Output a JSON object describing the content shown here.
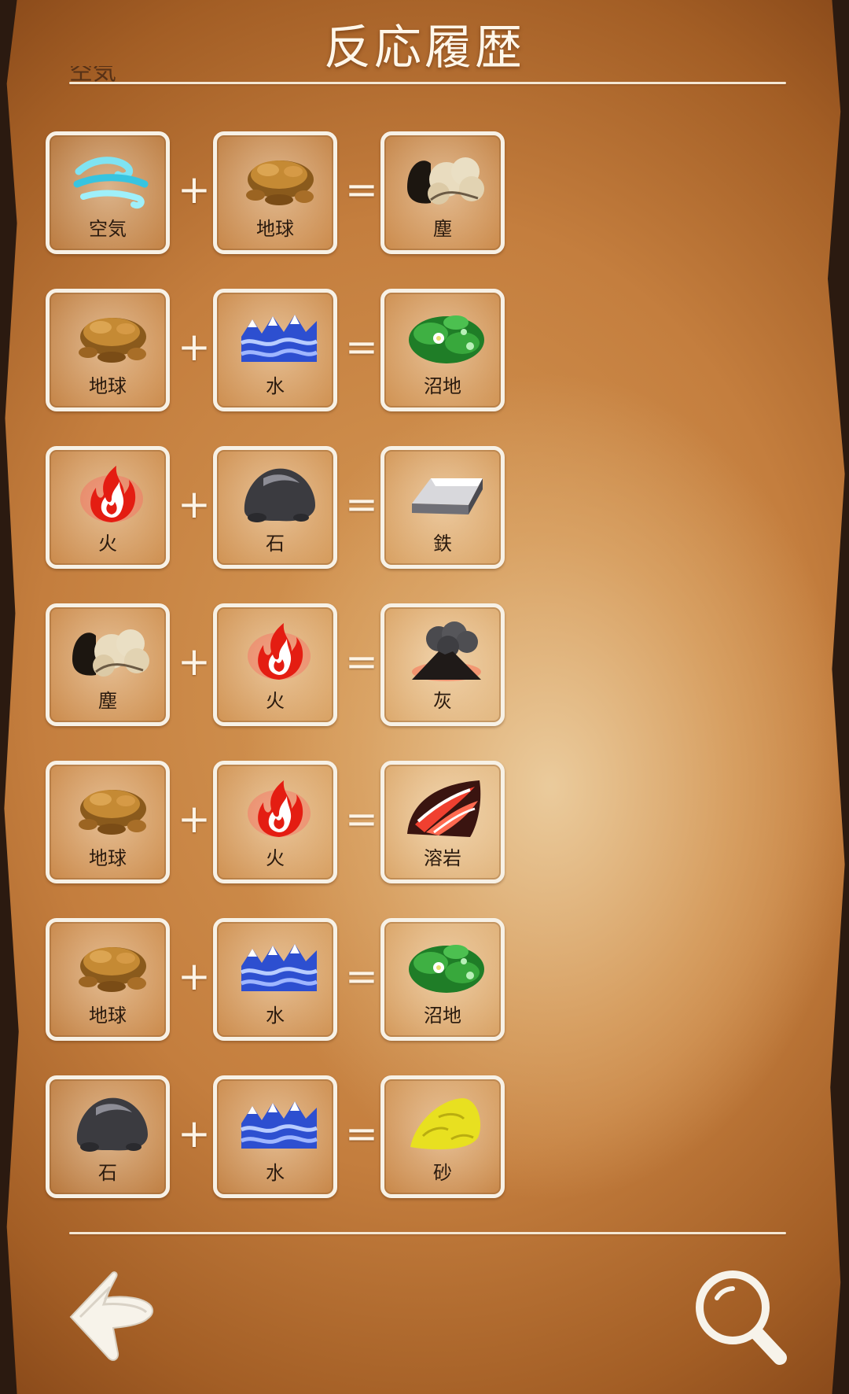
{
  "title": "反応履歴",
  "partial_text": "空気",
  "elements": {
    "air": {
      "label": "空気",
      "icon": "air-swirl-icon"
    },
    "earth": {
      "label": "地球",
      "icon": "earth-rock-icon"
    },
    "dust": {
      "label": "塵",
      "icon": "dust-cloud-icon"
    },
    "water": {
      "label": "水",
      "icon": "water-waves-icon"
    },
    "swamp": {
      "label": "沼地",
      "icon": "swamp-lilypad-icon"
    },
    "fire": {
      "label": "火",
      "icon": "fire-flame-icon"
    },
    "stone": {
      "label": "石",
      "icon": "stone-icon"
    },
    "iron": {
      "label": "鉄",
      "icon": "iron-ingot-icon"
    },
    "ash": {
      "label": "灰",
      "icon": "ash-volcano-icon"
    },
    "lava": {
      "label": "溶岩",
      "icon": "lava-icon"
    },
    "sand": {
      "label": "砂",
      "icon": "sand-pile-icon"
    }
  },
  "reactions": [
    {
      "a": {
        "label": "空気"
      },
      "b": {
        "label": "地球"
      },
      "result": {
        "label": "塵"
      }
    },
    {
      "a": {
        "label": "地球"
      },
      "b": {
        "label": "水"
      },
      "result": {
        "label": "沼地"
      }
    },
    {
      "a": {
        "label": "火"
      },
      "b": {
        "label": "石"
      },
      "result": {
        "label": "鉄"
      }
    },
    {
      "a": {
        "label": "塵"
      },
      "b": {
        "label": "火"
      },
      "result": {
        "label": "灰"
      }
    },
    {
      "a": {
        "label": "地球"
      },
      "b": {
        "label": "火"
      },
      "result": {
        "label": "溶岩"
      }
    },
    {
      "a": {
        "label": "地球"
      },
      "b": {
        "label": "水"
      },
      "result": {
        "label": "沼地"
      }
    },
    {
      "a": {
        "label": "石"
      },
      "b": {
        "label": "水"
      },
      "result": {
        "label": "砂"
      }
    }
  ],
  "operators": {
    "plus": "+",
    "equals": "="
  },
  "buttons": {
    "back_icon": "back-arrow-icon",
    "search_icon": "magnifier-icon"
  }
}
